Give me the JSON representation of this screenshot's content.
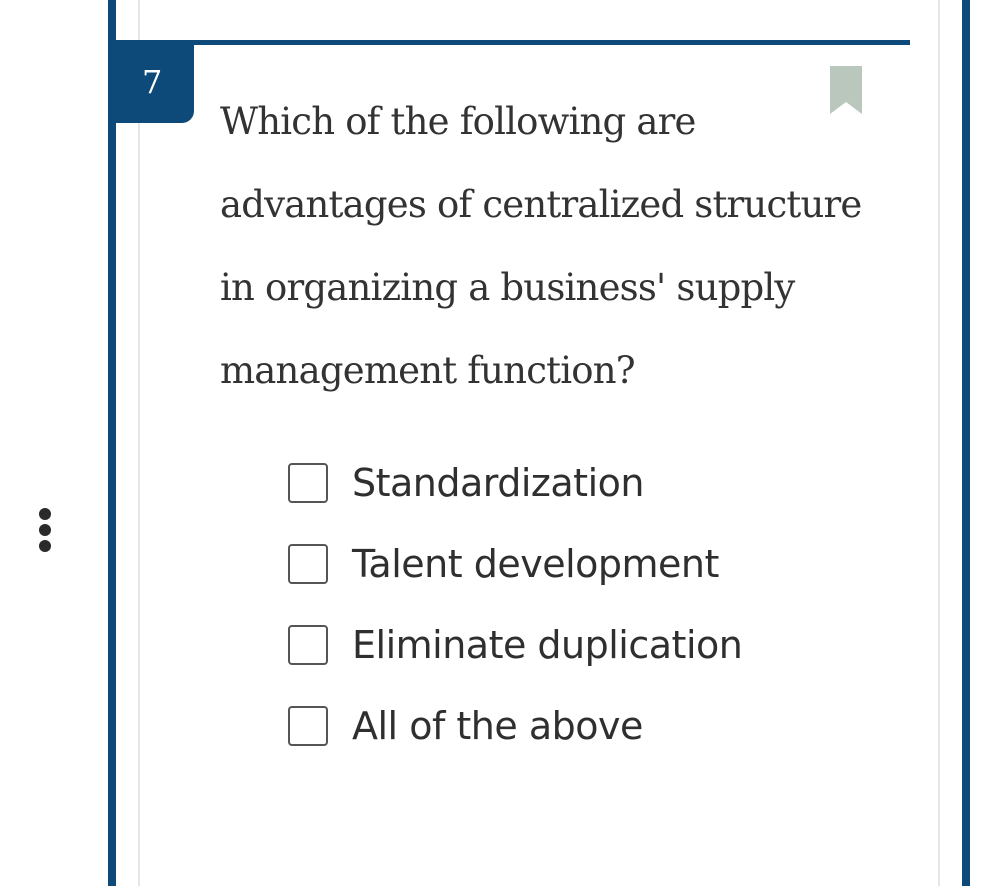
{
  "question": {
    "number": "7",
    "text": "Which of the following are advantages of centralized structure in organizing a business' supply management function?",
    "bookmark_icon": "bookmark-icon",
    "options": [
      {
        "label": "Standardization",
        "checked": false
      },
      {
        "label": "Talent development",
        "checked": false
      },
      {
        "label": "Eliminate duplication",
        "checked": false
      },
      {
        "label": "All of the above",
        "checked": false
      }
    ]
  },
  "side_menu": {
    "icon": "vertical-ellipsis-icon"
  },
  "colors": {
    "accent": "#0d4a7a",
    "bookmark": "#b9c7bd",
    "text": "#333333"
  }
}
